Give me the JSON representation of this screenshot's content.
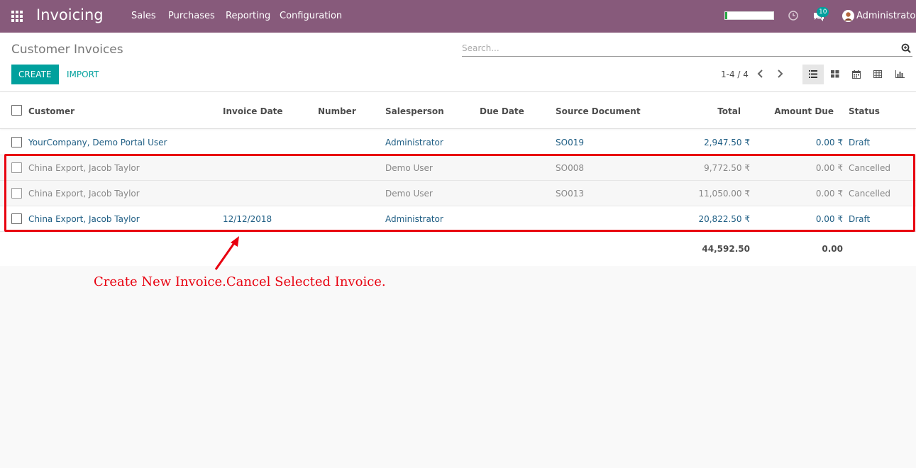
{
  "app": {
    "title": "Invoicing",
    "menu": [
      "Sales",
      "Purchases",
      "Reporting",
      "Configuration"
    ],
    "progress_fraction": 0.05,
    "messages_badge": "10",
    "user": "Administrator"
  },
  "control": {
    "page_title": "Customer Invoices",
    "search_placeholder": "Search...",
    "create_label": "CREATE",
    "import_label": "IMPORT",
    "pager": "1-4 / 4",
    "views": [
      "list-view-icon",
      "kanban-view-icon",
      "calendar-view-icon",
      "pivot-view-icon",
      "graph-view-icon"
    ],
    "active_view": "list-view-icon"
  },
  "table": {
    "headers": {
      "customer": "Customer",
      "invoice_date": "Invoice Date",
      "number": "Number",
      "salesperson": "Salesperson",
      "due_date": "Due Date",
      "source": "Source Document",
      "total": "Total",
      "amount_due": "Amount Due",
      "status": "Status"
    },
    "rows": [
      {
        "customer": "YourCompany, Demo Portal User",
        "invoice_date": "",
        "number": "",
        "salesperson": "Administrator",
        "due_date": "",
        "source": "SO019",
        "total": "2,947.50 ₹",
        "amount_due": "0.00 ₹",
        "status": "Draft"
      },
      {
        "customer": "China Export, Jacob Taylor",
        "invoice_date": "",
        "number": "",
        "salesperson": "Demo User",
        "due_date": "",
        "source": "SO008",
        "total": "9,772.50 ₹",
        "amount_due": "0.00 ₹",
        "status": "Cancelled"
      },
      {
        "customer": "China Export, Jacob Taylor",
        "invoice_date": "",
        "number": "",
        "salesperson": "Demo User",
        "due_date": "",
        "source": "SO013",
        "total": "11,050.00 ₹",
        "amount_due": "0.00 ₹",
        "status": "Cancelled"
      },
      {
        "customer": "China Export, Jacob Taylor",
        "invoice_date": "12/12/2018",
        "number": "",
        "salesperson": "Administrator",
        "due_date": "",
        "source": "",
        "total": "20,822.50 ₹",
        "amount_due": "0.00 ₹",
        "status": "Draft"
      }
    ],
    "totals": {
      "total": "44,592.50",
      "amount_due": "0.00"
    }
  },
  "annotation": {
    "text": "Create New Invoice.Cancel Selected Invoice.",
    "color": "#e8000f"
  },
  "colors": {
    "brand": "#875a7b",
    "accent": "#00a09d",
    "link": "#1f5e84"
  }
}
